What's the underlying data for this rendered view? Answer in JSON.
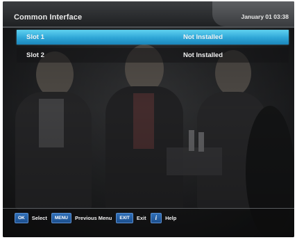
{
  "header": {
    "title": "Common Interface",
    "datetime": "January 01 03:38"
  },
  "slots": [
    {
      "name": "Slot 1",
      "status": "Not Installed",
      "selected": true
    },
    {
      "name": "Slot 2",
      "status": "Not Installed",
      "selected": false
    }
  ],
  "footer": {
    "hints": [
      {
        "key": "OK",
        "label": "Select",
        "icon": "ok-key-icon"
      },
      {
        "key": "MENU",
        "label": "Previous Menu",
        "icon": "menu-key-icon"
      },
      {
        "key": "EXIT",
        "label": "Exit",
        "icon": "exit-key-icon"
      },
      {
        "key": "i",
        "label": "Help",
        "icon": "info-key-icon"
      }
    ]
  },
  "colors": {
    "selection": "#2ea5d6",
    "key": "#1c4f8e"
  }
}
